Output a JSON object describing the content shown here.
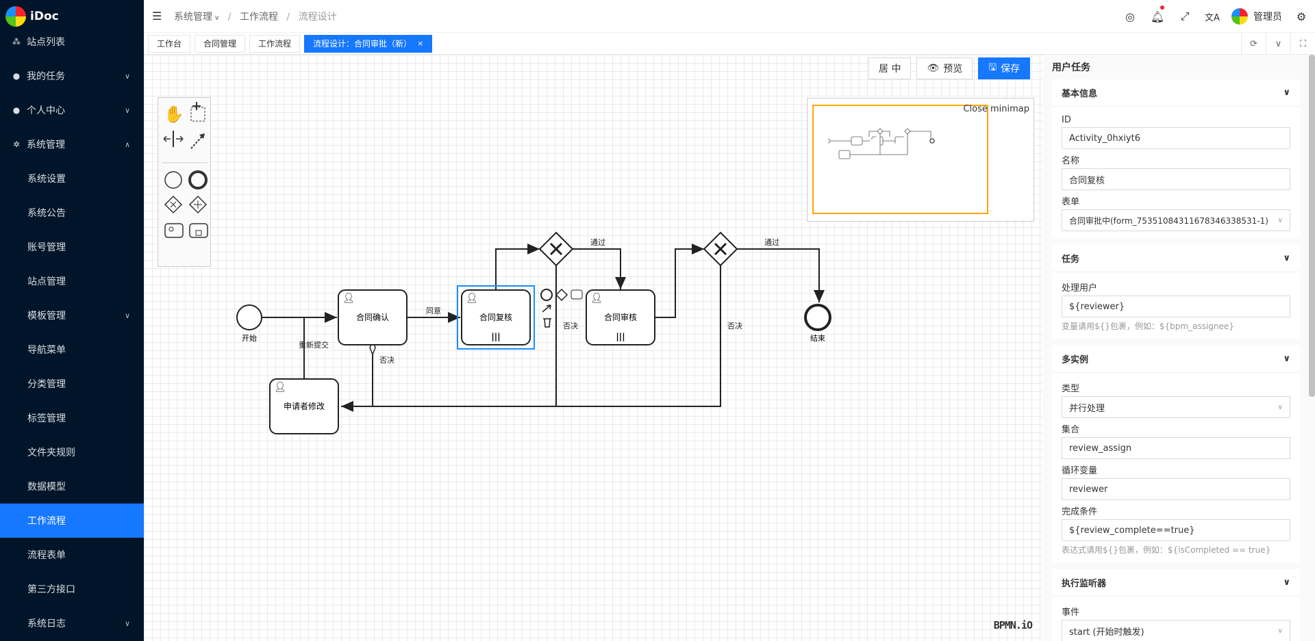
{
  "app": {
    "name": "iDoc"
  },
  "sidebar": {
    "items": [
      {
        "label": "站点列表",
        "icon": "sitemap-icon",
        "sub": false
      },
      {
        "label": "我的任务",
        "icon": "task-icon",
        "sub": false,
        "caret": "down"
      },
      {
        "label": "个人中心",
        "icon": "user-icon",
        "sub": false,
        "caret": "down"
      },
      {
        "label": "系统管理",
        "icon": "gear-icon",
        "sub": false,
        "caret": "up"
      },
      {
        "label": "系统设置",
        "sub": true
      },
      {
        "label": "系统公告",
        "sub": true
      },
      {
        "label": "账号管理",
        "sub": true
      },
      {
        "label": "站点管理",
        "sub": true
      },
      {
        "label": "模板管理",
        "sub": true,
        "caret": "down"
      },
      {
        "label": "导航菜单",
        "sub": true
      },
      {
        "label": "分类管理",
        "sub": true
      },
      {
        "label": "标签管理",
        "sub": true
      },
      {
        "label": "文件夹规则",
        "sub": true
      },
      {
        "label": "数据模型",
        "sub": true
      },
      {
        "label": "工作流程",
        "sub": true,
        "active": true
      },
      {
        "label": "流程表单",
        "sub": true
      },
      {
        "label": "第三方接口",
        "sub": true
      },
      {
        "label": "系统日志",
        "sub": true,
        "caret": "down"
      }
    ]
  },
  "breadcrumb": {
    "items": [
      "系统管理",
      "工作流程",
      "流程设计"
    ]
  },
  "header": {
    "user": "管理员"
  },
  "tabs": [
    {
      "label": "工作台"
    },
    {
      "label": "合同管理"
    },
    {
      "label": "工作流程"
    },
    {
      "label": "流程设计：合同审批（新）",
      "active": true
    }
  ],
  "toolbar": {
    "center": "居 中",
    "preview": "预览",
    "save": "保存"
  },
  "minimap": {
    "close": "Close minimap"
  },
  "diagram": {
    "start": "开始",
    "end": "结束",
    "task1": "合同确认",
    "task2": "合同复核",
    "task3": "合同审核",
    "task4": "申请者修改",
    "agree": "同意",
    "pass1": "通过",
    "pass2": "通过",
    "reject1": "否决",
    "reject2": "否决",
    "reject3": "否决",
    "resubmit": "重新提交"
  },
  "brand": "BPMN.iO",
  "panel": {
    "title": "用户任务",
    "basic": {
      "title": "基本信息",
      "id_label": "ID",
      "id": "Activity_0hxiyt6",
      "name_label": "名称",
      "name": "合同复核",
      "form_label": "表单",
      "form": "合同审批中(form_753510843116783463385​31-1)"
    },
    "task": {
      "title": "任务",
      "user_label": "处理用户",
      "user": "${reviewer}",
      "hint": "变量请用${}包裹，例如：${bpm_assignee}"
    },
    "multi": {
      "title": "多实例",
      "type_label": "类型",
      "type": "并行处理",
      "coll_label": "集合",
      "coll": "review_assign",
      "var_label": "循环变量",
      "var": "reviewer",
      "cond_label": "完成条件",
      "cond": "${review_complete==true}",
      "hint": "表达式请用${}包裹，例如：${isCompleted == true}"
    },
    "listener": {
      "title": "执行监听器",
      "event_label": "事件",
      "event": "start (开始时触发)"
    }
  }
}
